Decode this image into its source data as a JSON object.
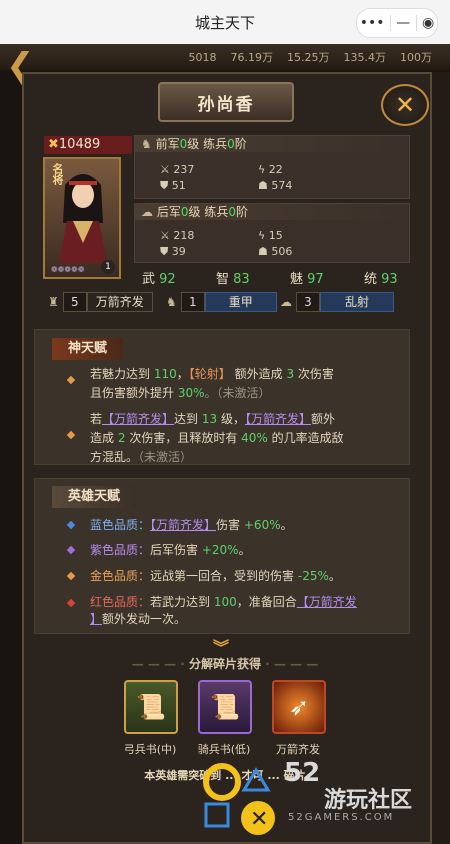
{
  "window": {
    "title": "城主天下",
    "menu_icon": "more-dots-icon",
    "min_icon": "minus-icon",
    "close_icon": "target-icon"
  },
  "resources": [
    "5018",
    "76.19万",
    "15.25万",
    "135.4万",
    "100万"
  ],
  "hero": {
    "name": "孙尚香",
    "power": "10489",
    "portrait_badge": "名将",
    "portrait_level": "1"
  },
  "front_army": {
    "label": "前军",
    "grade": "0",
    "grade_suffix": "级",
    "train": "练兵",
    "train_val": "0",
    "train_suffix": "阶",
    "attack": "237",
    "power": "22",
    "defense": "51",
    "hp": "574"
  },
  "back_army": {
    "label": "后军",
    "grade": "0",
    "grade_suffix": "级",
    "train": "练兵",
    "train_val": "0",
    "train_suffix": "阶",
    "attack": "218",
    "power": "15",
    "defense": "39",
    "hp": "506"
  },
  "attributes": [
    {
      "k": "武",
      "v": "92"
    },
    {
      "k": "智",
      "v": "83"
    },
    {
      "k": "魅",
      "v": "97"
    },
    {
      "k": "统",
      "v": "93"
    }
  ],
  "formations": [
    {
      "num": "5",
      "name": "万箭齐发"
    },
    {
      "num": "1",
      "name": "重甲"
    },
    {
      "num": "3",
      "name": "乱射"
    }
  ],
  "divine_talent": {
    "title": "神天赋",
    "line1_a": "若魅力达到",
    "line1_b": "110",
    "line1_c": "，",
    "line1_d": "【轮射】",
    "line1_e": "额外造成",
    "line1_f": "3",
    "line1_g": "次伤害",
    "line2_a": "且伤害额外提升",
    "line2_b": "30%",
    "line2_c": "。（未激活）",
    "line3_a": "若",
    "line3_b": "【万箭齐发】",
    "line3_c": "达到",
    "line3_d": "13",
    "line3_e": "级，",
    "line3_f": "【万箭齐发】",
    "line3_g": "额外",
    "line4_a": "造成",
    "line4_b": "2",
    "line4_c": "次伤害，且释放时有",
    "line4_d": "40%",
    "line4_e": "的几率造成敌",
    "line5_a": "方混乱。",
    "line5_b": "（未激活）"
  },
  "hero_talent": {
    "title": "英雄天赋",
    "blue_a": "蓝色品质：",
    "blue_b": "【万箭齐发】",
    "blue_c": "伤害",
    "blue_d": "+60%",
    "blue_e": "。",
    "purple_a": "紫色品质：",
    "purple_b": "后军伤害",
    "purple_c": "+20%",
    "purple_d": "。",
    "gold_a": "金色品质：",
    "gold_b": "远战第一回合，受到的伤害",
    "gold_c": "-25%",
    "gold_d": "。",
    "red_a": "红色品质：",
    "red_b": "若武力达到",
    "red_c": "100",
    "red_d": "，准备回合",
    "red_e": "【万箭齐发",
    "red_f": "】",
    "red_g": "额外发动一次。"
  },
  "decompose": {
    "title": "分解碎片获得",
    "items": [
      {
        "label": "弓兵书(中)",
        "icon": "scroll-bow-icon"
      },
      {
        "label": "骑兵书(低)",
        "icon": "scroll-cavalry-icon"
      },
      {
        "label": "万箭齐发",
        "icon": "arrow-volley-icon"
      }
    ],
    "footer": "本英雄需突破到 ...  才可 ... 碎片"
  },
  "watermark": {
    "number": "52",
    "name": "游玩社区",
    "site": "52GAMERS.COM"
  }
}
